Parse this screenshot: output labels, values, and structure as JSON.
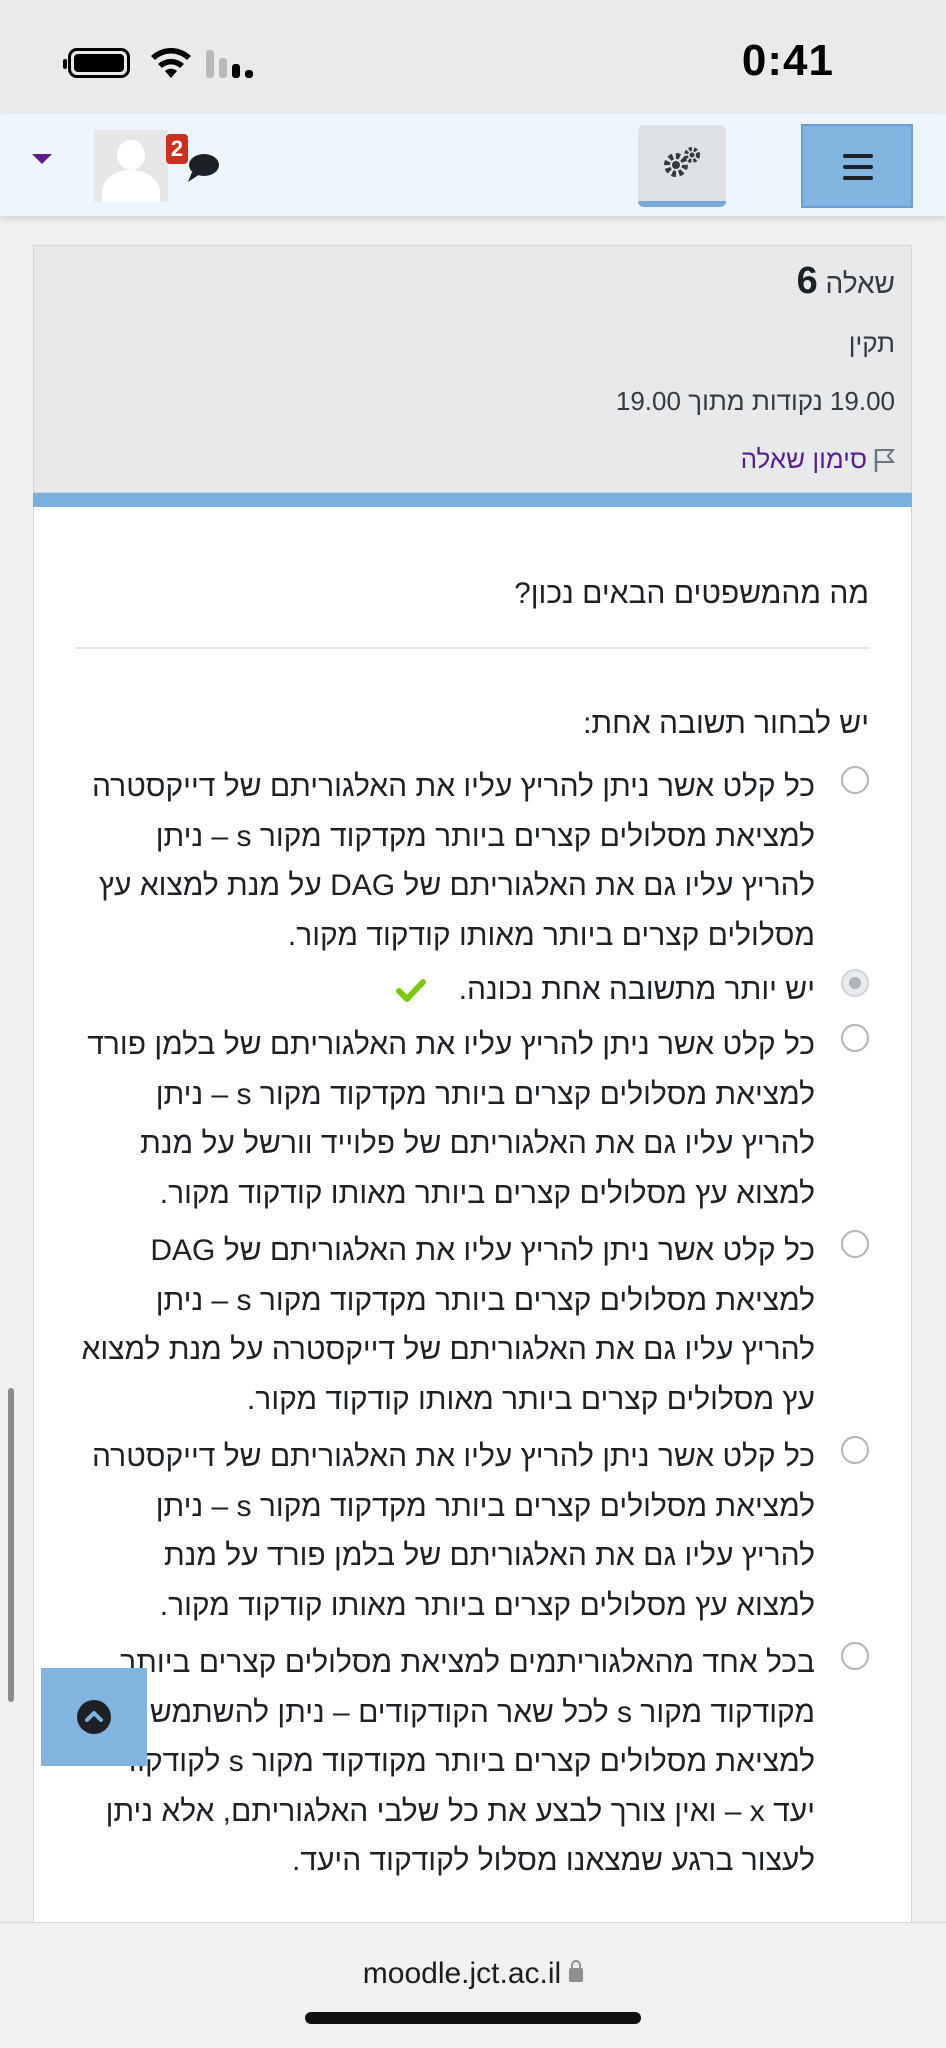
{
  "status_bar": {
    "time": "0:41"
  },
  "navbar": {
    "notification_count": "2",
    "icons": [
      "user-menu-caret-icon",
      "avatar",
      "chat-icon",
      "gear-icon",
      "hamburger-menu-icon"
    ]
  },
  "question_info": {
    "label": "שאלה",
    "number": "6",
    "state": "תקין",
    "grade": "19.00 נקודות מתוך 19.00",
    "flag_label": "סימון שאלה"
  },
  "question": {
    "text": "מה מהמשפטים הבאים נכון?",
    "prompt": "יש לבחור תשובה אחת:",
    "answers": [
      {
        "text": "כל קלט אשר ניתן להריץ עליו את האלגוריתם של דייקסטרה למציאת מסלולים קצרים ביותר מקדקוד מקור s – ניתן להריץ עליו גם את האלגוריתם של DAG על מנת למצוא עץ מסלולים קצרים ביותר מאותו קודקוד מקור.",
        "selected": false
      },
      {
        "text": "יש יותר מתשובה אחת נכונה.",
        "selected": true,
        "correct": true
      },
      {
        "text": "כל קלט אשר ניתן להריץ עליו את האלגוריתם של בלמן פורד למציאת מסלולים קצרים ביותר מקדקוד מקור s – ניתן להריץ עליו גם את האלגוריתם של פלוייד וורשל על מנת למצוא עץ מסלולים קצרים ביותר מאותו קודקוד מקור.",
        "selected": false
      },
      {
        "text": "כל קלט אשר ניתן להריץ עליו את האלגוריתם של DAG למציאת מסלולים קצרים ביותר מקדקוד מקור s – ניתן להריץ עליו גם את האלגוריתם של דייקסטרה על מנת למצוא עץ מסלולים קצרים ביותר מאותו קודקוד מקור.",
        "selected": false
      },
      {
        "text": "כל קלט אשר ניתן להריץ עליו את האלגוריתם של דייקסטרה למציאת מסלולים קצרים ביותר מקדקוד מקור s – ניתן להריץ עליו גם את האלגוריתם של בלמן פורד על מנת למצוא עץ מסלולים קצרים ביותר מאותו קודקוד מקור.",
        "selected": false
      },
      {
        "text": "בכל אחד מהאלגוריתמים למציאת מסלולים קצרים ביותר מקודקוד מקור s לכל שאר הקודקודים – ניתן להשתמש גם למציאת מסלולים קצרים ביותר מקודקוד מקור s לקודקוד יעד x – ואין צורך לבצע את כל שלבי האלגוריתם, אלא ניתן לעצור ברגע שמצאנו מסלול לקודקוד היעד.",
        "selected": false
      }
    ]
  },
  "browser": {
    "url": "moodle.jct.ac.il"
  },
  "colors": {
    "accent_blue": "#82b4e0",
    "link_purple": "#5a1e8c",
    "correct_green": "#5cb85c",
    "badge_red": "#ca3120"
  }
}
